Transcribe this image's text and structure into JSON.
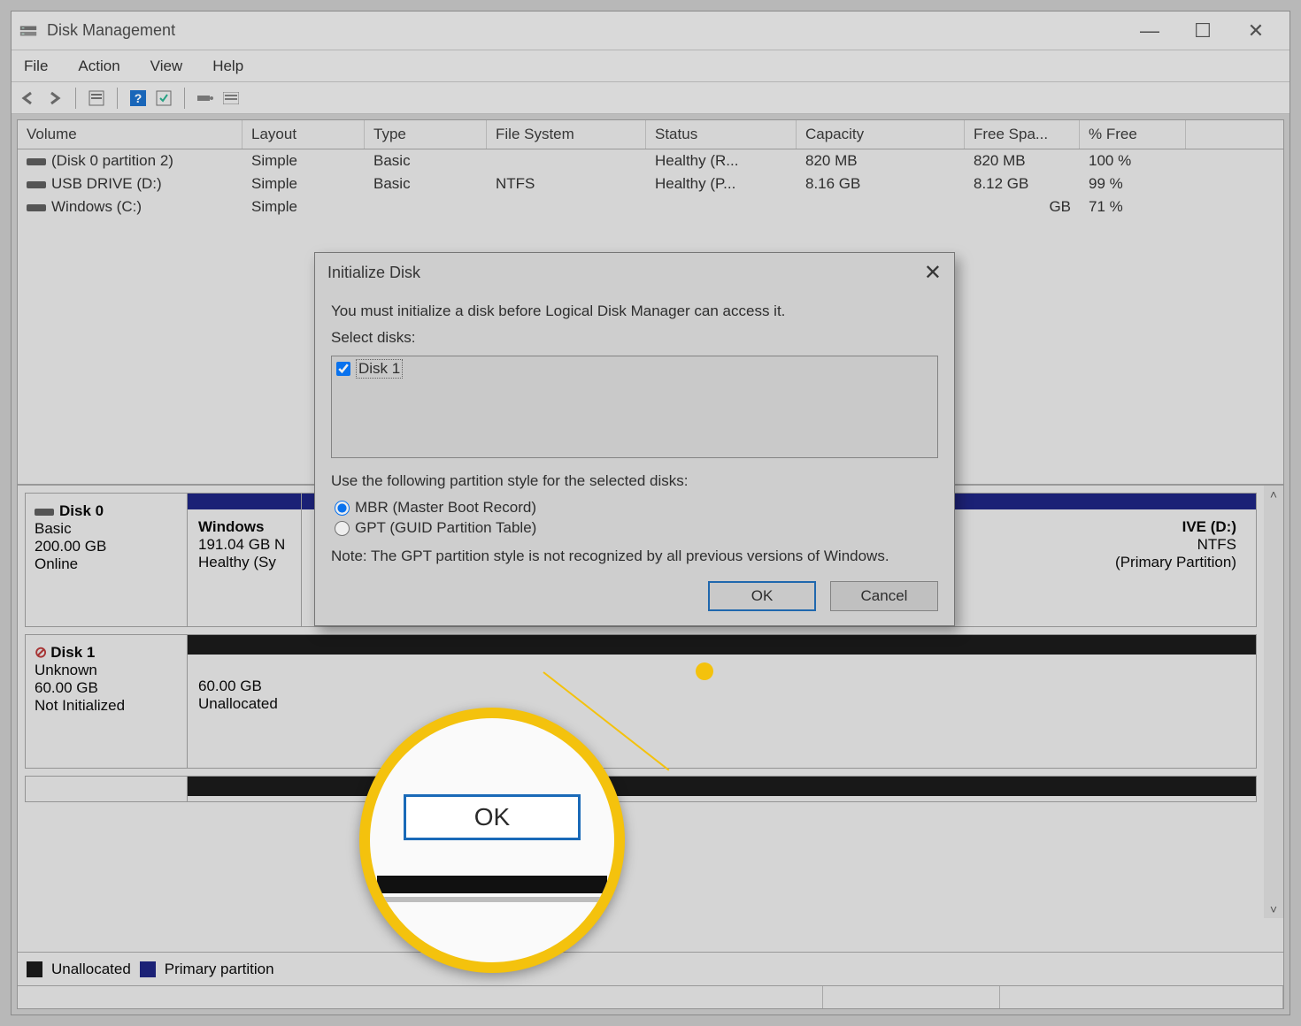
{
  "window": {
    "title": "Disk Management"
  },
  "menu": {
    "file": "File",
    "action": "Action",
    "view": "View",
    "help": "Help"
  },
  "columns": {
    "volume": "Volume",
    "layout": "Layout",
    "type": "Type",
    "fs": "File System",
    "status": "Status",
    "capacity": "Capacity",
    "free": "Free Spa...",
    "pct": "% Free"
  },
  "volumes": [
    {
      "name": "(Disk 0 partition 2)",
      "layout": "Simple",
      "type": "Basic",
      "fs": "",
      "status": "Healthy (R...",
      "capacity": "820 MB",
      "free": "820 MB",
      "pct": "100 %"
    },
    {
      "name": "USB DRIVE (D:)",
      "layout": "Simple",
      "type": "Basic",
      "fs": "NTFS",
      "status": "Healthy (P...",
      "capacity": "8.16 GB",
      "free": "8.12 GB",
      "pct": "99 %"
    },
    {
      "name": "Windows (C:)",
      "layout": "Simple",
      "type": "",
      "fs": "",
      "status": "",
      "capacity": "",
      "free": "GB",
      "pct": "71 %"
    }
  ],
  "disk0": {
    "label": "Disk 0",
    "type": "Basic",
    "size": "200.00 GB",
    "state": "Online",
    "part1": {
      "name": "Windows",
      "size": "191.04 GB N",
      "status": "Healthy (Sy"
    },
    "part2": {
      "name": "IVE (D:)",
      "fs": "NTFS",
      "status": "(Primary Partition)"
    }
  },
  "disk1": {
    "label": "Disk 1",
    "type": "Unknown",
    "size": "60.00 GB",
    "state": "Not Initialized",
    "part": {
      "size": "60.00 GB",
      "status": "Unallocated"
    }
  },
  "legend": {
    "unalloc": "Unallocated",
    "primary": "Primary partition"
  },
  "dialog": {
    "title": "Initialize Disk",
    "msg": "You must initialize a disk before Logical Disk Manager can access it.",
    "select_label": "Select disks:",
    "disk_item": "Disk 1",
    "style_label": "Use the following partition style for the selected disks:",
    "mbr": "MBR (Master Boot Record)",
    "gpt": "GPT (GUID Partition Table)",
    "note": "Note: The GPT partition style is not recognized by all previous versions of Windows.",
    "ok": "OK",
    "cancel": "Cancel"
  },
  "callout": {
    "ok": "OK"
  }
}
